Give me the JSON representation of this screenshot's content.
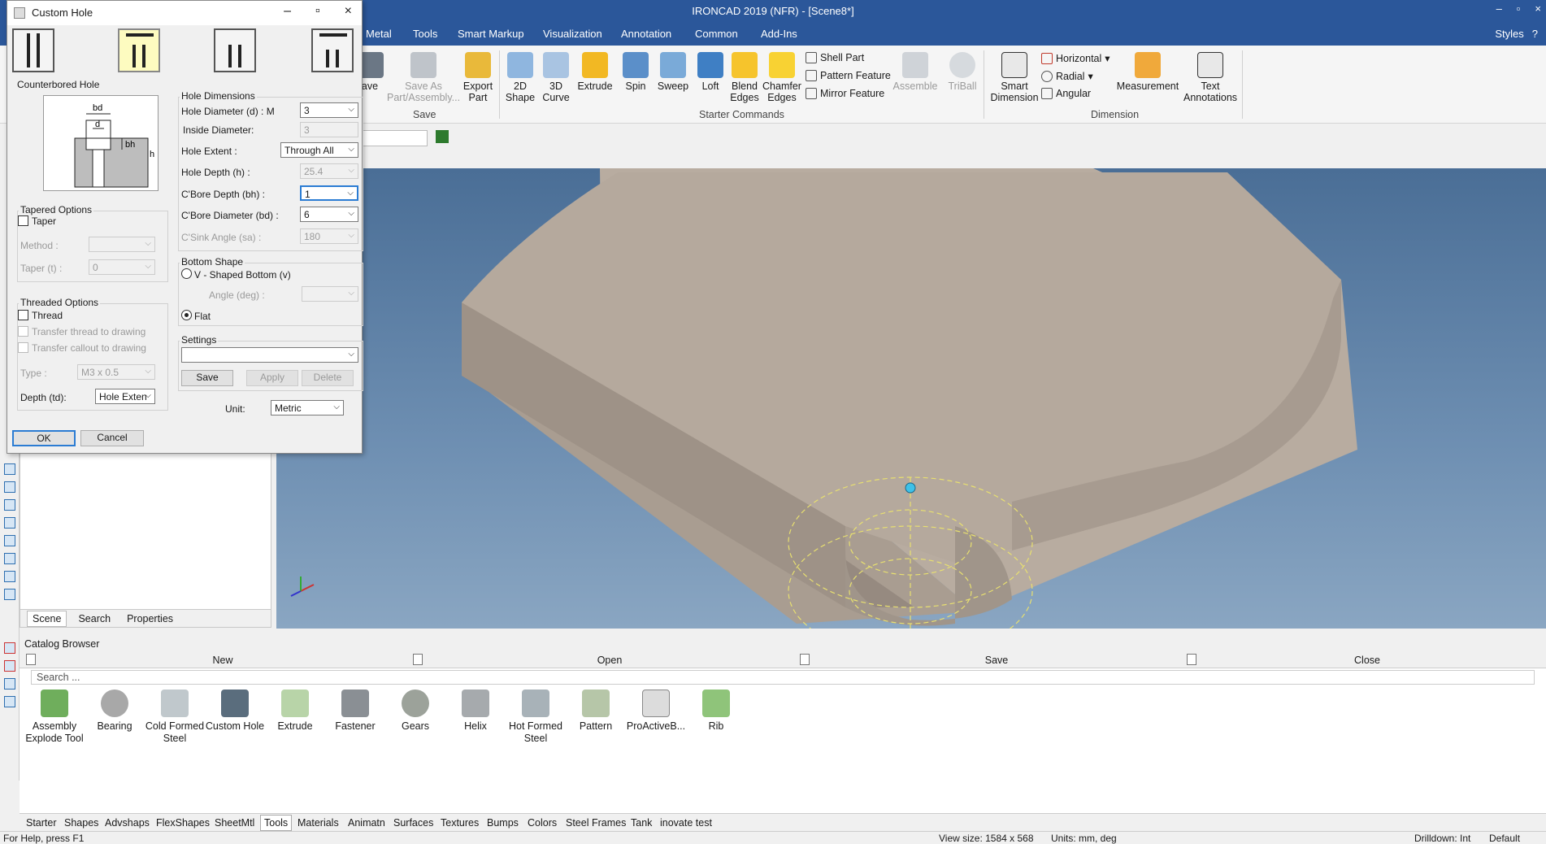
{
  "app": {
    "title": "IRONCAD 2019 (NFR) - [Scene8*]",
    "win_min": "–",
    "win_max": "▫",
    "win_close": "×"
  },
  "menu": {
    "tabs": [
      "Metal",
      "Tools",
      "Smart Markup",
      "Visualization",
      "Annotation",
      "Common",
      "Add-Ins"
    ],
    "styles": "Styles",
    "help": "?"
  },
  "ribbon": {
    "save": "ave",
    "save_as": "Save As\nPart/Assembly...",
    "export": "Export\nPart",
    "save_group": "Save",
    "shape2d": "2D\nShape",
    "curve3d": "3D\nCurve",
    "extrude": "Extrude",
    "spin": "Spin",
    "sweep": "Sweep",
    "loft": "Loft",
    "blend": "Blend\nEdges",
    "chamfer": "Chamfer\nEdges",
    "shell": "Shell Part",
    "pattern": "Pattern Feature",
    "mirror": "Mirror Feature",
    "assemble": "Assemble",
    "triball": "TriBall",
    "starter_group": "Starter Commands",
    "smart_dim": "Smart\nDimension",
    "horizontal": "Horizontal",
    "radial": "Radial",
    "angular": "Angular",
    "measurement": "Measurement",
    "text_ann": "Text\nAnnotations",
    "dimension_group": "Dimension"
  },
  "dialog": {
    "title": "Custom Hole",
    "hole_type_label": "Counterbored Hole",
    "dimensions_group": "Hole Dimensions",
    "hole_diameter_label": "Hole Diameter (d) : M",
    "hole_diameter_value": "3",
    "inside_diameter_label": "Inside Diameter:",
    "inside_diameter_value": "3",
    "hole_extent_label": "Hole Extent :",
    "hole_extent_value": "Through All",
    "hole_depth_label": "Hole Depth (h) :",
    "hole_depth_value": "25.4",
    "cbore_depth_label": "C'Bore Depth (bh) :",
    "cbore_depth_value": "1",
    "cbore_diameter_label": "C'Bore Diameter (bd) :",
    "cbore_diameter_value": "6",
    "csink_angle_label": "C'Sink Angle (sa) :",
    "csink_angle_value": "180",
    "tapered_group": "Tapered Options",
    "taper_label": "Taper",
    "method_label": "Method :",
    "method_value": "",
    "taper_t_label": "Taper (t) :",
    "taper_t_value": "0",
    "bottom_group": "Bottom Shape",
    "vshaped_label": "V - Shaped Bottom (v)",
    "angle_label": "Angle (deg) :",
    "angle_value": "",
    "flat_label": "Flat",
    "threaded_group": "Threaded Options",
    "thread_label": "Thread",
    "transfer_thread_label": "Transfer thread to drawing",
    "transfer_callout_label": "Transfer callout to drawing",
    "type_label": "Type :",
    "type_value": "M3 x 0.5",
    "depth_td_label": "Depth (td):",
    "depth_td_value": "Hole Exten",
    "settings_group": "Settings",
    "settings_value": "",
    "save_btn": "Save",
    "apply_btn": "Apply",
    "delete_btn": "Delete",
    "unit_label": "Unit:",
    "unit_value": "Metric",
    "ok_btn": "OK",
    "cancel_btn": "Cancel",
    "diagram": {
      "bd": "bd",
      "d": "d",
      "bh": "bh",
      "h": "h"
    }
  },
  "scene_tabs": [
    "Scene",
    "Search",
    "Properties"
  ],
  "catalog": {
    "title": "Catalog Browser",
    "actions": [
      "New",
      "Open",
      "Save",
      "Close"
    ],
    "search_placeholder": "Search ...",
    "items": [
      "Assembly\nExplode Tool",
      "Bearing",
      "Cold Formed\nSteel",
      "Custom Hole",
      "Extrude",
      "Fastener",
      "Gears",
      "Helix",
      "Hot Formed\nSteel",
      "Pattern",
      "ProActiveB...",
      "Rib"
    ],
    "tabs": [
      "Starter",
      "Shapes",
      "Advshaps",
      "FlexShapes",
      "SheetMtl",
      "Tools",
      "Materials",
      "Animatn",
      "Surfaces",
      "Textures",
      "Bumps",
      "Colors",
      "Steel Frames",
      "Tank",
      "inovate test"
    ],
    "active_tab": "Tools"
  },
  "status": {
    "help": "For Help, press F1",
    "view_size": "View size: 1584 x 568",
    "units": "Units: mm, deg",
    "drilldown": "Drilldown: Int",
    "default": "Default"
  },
  "colors": {
    "accent": "#2b579a",
    "part": "#b3a79c"
  }
}
